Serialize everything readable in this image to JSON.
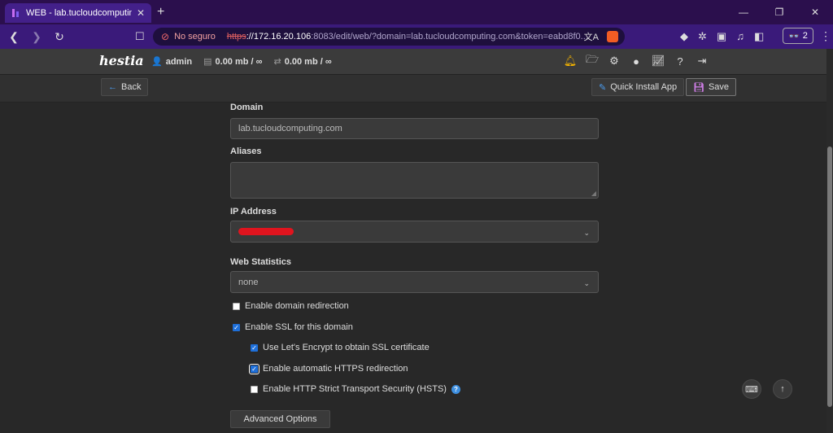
{
  "browser": {
    "tab_title": "WEB - lab.tucloudcomputing.com",
    "security_label": "No seguro",
    "url_scheme": "https",
    "url_host": "://172.16.20.106",
    "url_rest": ":8083/edit/web/?domain=lab.tucloudcomputing.com&token=eabd8f0...",
    "wallet_count": "2"
  },
  "header": {
    "logo": "hestia",
    "username": "admin",
    "disk": "0.00 mb / ∞",
    "bandwidth": "0.00 mb / ∞"
  },
  "actions": {
    "back_label": "Back",
    "quick_install_label": "Quick Install App",
    "save_label": "Save"
  },
  "form": {
    "domain_label": "Domain",
    "domain_value": "lab.tucloudcomputing.com",
    "aliases_label": "Aliases",
    "aliases_value": "",
    "ip_label": "IP Address",
    "stats_label": "Web Statistics",
    "stats_value": "none",
    "redirect_label": "Enable domain redirection",
    "ssl_label": "Enable SSL for this domain",
    "letsencrypt_label": "Use Let's Encrypt to obtain SSL certificate",
    "https_redirect_label": "Enable automatic HTTPS redirection",
    "hsts_label": "Enable HTTP Strict Transport Security (HSTS)",
    "advanced_label": "Advanced Options"
  }
}
